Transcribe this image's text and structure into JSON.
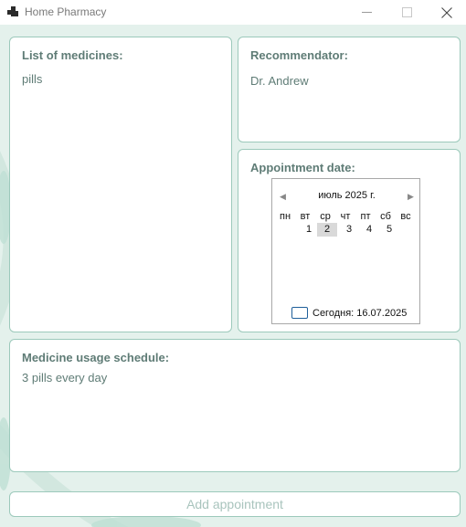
{
  "window": {
    "title": "Home Pharmacy",
    "icon": "app-window-icon",
    "controls": [
      "minimize-icon",
      "maximize-icon",
      "close-icon"
    ]
  },
  "colors": {
    "background": "#e4f1ec",
    "panel_border": "#9cc9bb",
    "label_text": "#5f7c76",
    "button_text": "#a9c4bd"
  },
  "medicines": {
    "title": "List of medicines:",
    "items": [
      "pills"
    ]
  },
  "recommendator": {
    "title": "Recommendator:",
    "value": "Dr. Andrew"
  },
  "appointment": {
    "title": "Appointment date:",
    "calendar": {
      "month_label": "июль 2025 г.",
      "weekdays": [
        "пн",
        "вт",
        "ср",
        "чт",
        "пт",
        "сб",
        "вс"
      ],
      "days": [
        "1",
        "2",
        "3",
        "4",
        "5"
      ],
      "selected_day": "2",
      "today_label": "Сегодня: 16.07.2025"
    }
  },
  "schedule": {
    "title": "Medicine usage schedule:",
    "value": "3 pills every day"
  },
  "add_button": {
    "label": "Add appointment"
  }
}
